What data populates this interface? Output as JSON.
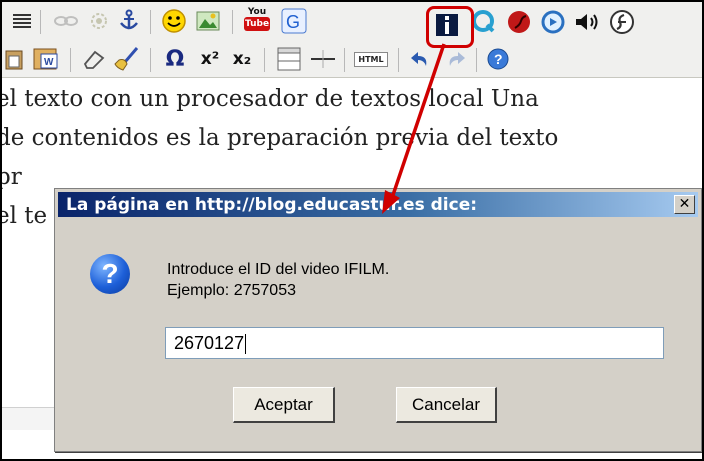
{
  "toolbar_top": {
    "icons": [
      "justify-icon",
      "link-icon",
      "unlink-icon",
      "anchor-icon",
      "smiley-icon",
      "image-icon",
      "youtube-icon",
      "google-video-icon",
      "ifilm-icon",
      "quicktime-icon",
      "flash-media-icon",
      "circle-arrow-icon",
      "speaker-icon",
      "flash-icon"
    ],
    "youtube_label": "You\nTube"
  },
  "toolbar_bottom": {
    "icons": [
      "paste-icon",
      "paste-word-icon",
      "eraser-icon",
      "cleanup-icon",
      "omega-icon",
      "superscript-icon",
      "subscript-icon",
      "insert-table-icon",
      "horizontal-rule-icon",
      "html-icon",
      "undo-icon",
      "redo-icon",
      "help-icon"
    ],
    "html_label": "HTML",
    "omega_label": "Ω",
    "superscript_label": "x²",
    "subscript_label": "x₂"
  },
  "editor": {
    "lines": [
      "el texto con un procesador de textos local Una",
      "de contenidos es la preparación previa del texto",
      "pr",
      "el te"
    ]
  },
  "dialog": {
    "title": "La página en http://blog.educastur.es dice:",
    "message_line1": "Introduce el ID del video IFILM.",
    "message_line2": "Ejemplo: 2757053",
    "input_value": "2670127",
    "ok_label": "Aceptar",
    "cancel_label": "Cancelar",
    "close_glyph": "✕"
  },
  "colors": {
    "highlight": "#d00000",
    "titlebar": "#0a246a",
    "dialog_bg": "#d4d0c8"
  }
}
